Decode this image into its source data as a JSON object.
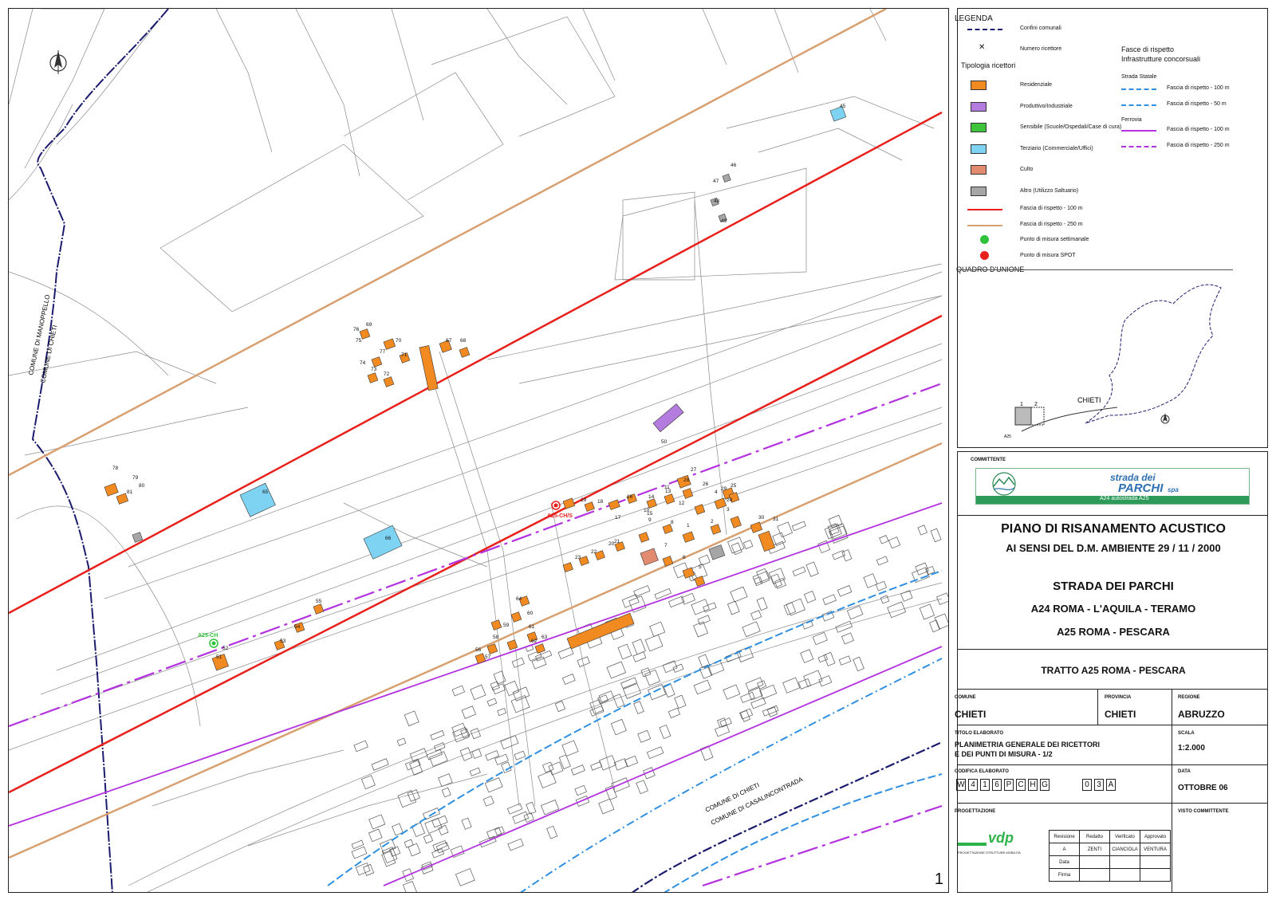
{
  "map": {
    "sheet_number": "1",
    "north_arrow_icon": "north-arrow-icon",
    "municipality_labels": [
      "COMUNE DI MANOPPELLO",
      "COMUNE DI CHIETI",
      "COMUNE DI CHIETI",
      "COMUNE DI CASALINCONTRADA"
    ],
    "measure_points": [
      {
        "id": "A25-CH/S",
        "type": "SPOT",
        "color": "#e8201c"
      },
      {
        "id": "A25-CH",
        "type": "settimanale",
        "color": "#2fc23a"
      }
    ],
    "receptor_numbers": [
      "1",
      "2",
      "3",
      "4",
      "5",
      "6",
      "7",
      "8",
      "9",
      "10",
      "11",
      "12",
      "13",
      "14",
      "15",
      "16",
      "17",
      "18",
      "19",
      "20",
      "21",
      "22",
      "23",
      "24",
      "25",
      "26",
      "27",
      "28",
      "29",
      "30",
      "31",
      "45",
      "46",
      "47",
      "48",
      "49",
      "50",
      "51",
      "52",
      "53",
      "54",
      "55",
      "56",
      "57",
      "58",
      "59",
      "60",
      "61",
      "62",
      "63",
      "64",
      "65",
      "66",
      "67",
      "68",
      "69",
      "70",
      "71",
      "72",
      "73",
      "74",
      "75",
      "76",
      "77",
      "78",
      "79",
      "80",
      "81"
    ],
    "colors": {
      "residenziale": "#f28a22",
      "produttivo": "#b57ce0",
      "sensibile": "#3ec43a",
      "terziario": "#7fd3f2",
      "culto": "#e28b70",
      "altro": "#a6a6a6",
      "fascia_100": "#e8201c",
      "fascia_250": "#d8a070",
      "strada_statale": "#2f8fe0",
      "ferrovia": "#b332e0",
      "confini": "#1c1c6e"
    }
  },
  "legend": {
    "title": "LEGENDA",
    "confini": "Confini comunali",
    "numero_ricettore": "Numero ricettore",
    "tipologia_title": "Tipologia ricettori",
    "types": [
      {
        "label": "Residenziale",
        "color": "#f28a22"
      },
      {
        "label": "Produttivo/Industriale",
        "color": "#b57ce0"
      },
      {
        "label": "Sensibile (Scuole/Ospedali/Case di cura)",
        "color": "#3ec43a"
      },
      {
        "label": "Terziario (Commerciale/Uffici)",
        "color": "#7fd3f2"
      },
      {
        "label": "Culto",
        "color": "#e28b70"
      },
      {
        "label": "Altro (Utilizzo Saltuario)",
        "color": "#a6a6a6"
      }
    ],
    "fascia_100": "Fascia di rispetto - 100 m",
    "fascia_250": "Fascia di rispetto - 250 m",
    "punto_settimanale": "Punto di misura settimanale",
    "punto_spot": "Punto di misura SPOT",
    "concorsuali_title_1": "Fasce di rispetto",
    "concorsuali_title_2": "Infrastrutture concorsuali",
    "strada_statale": "Strada Statale",
    "ss_100": "Fascia di rispetto - 100 m",
    "ss_50": "Fascia di rispetto - 50 m",
    "ferrovia": "Ferrovia",
    "fer_100": "Fascia di rispetto - 100 m",
    "fer_250": "Fascia di rispetto - 250 m",
    "quadro_title": "QUADRO D'UNIONE",
    "quadro_city": "CHIETI",
    "quadro_tiles": [
      "1",
      "2"
    ],
    "quadro_road": "A25"
  },
  "title_block": {
    "committente_label": "COMMITTENTE",
    "logo_line1": "strada dei",
    "logo_line2": "PARCHI",
    "logo_line2_suffix": "spa",
    "logo_bar": "A24 autostrada A25",
    "main_title": "PIANO DI RISANAMENTO ACUSTICO",
    "main_subtitle": "AI SENSI DEL D.M. AMBIENTE 29 / 11 / 2000",
    "project_1": "STRADA DEI PARCHI",
    "project_2": "A24 ROMA - L'AQUILA - TERAMO",
    "project_3": "A25 ROMA - PESCARA",
    "tratto": "TRATTO A25 ROMA - PESCARA",
    "comune_label": "COMUNE",
    "comune": "CHIETI",
    "provincia_label": "PROVINCIA",
    "provincia": "CHIETI",
    "regione_label": "REGIONE",
    "regione": "ABRUZZO",
    "titolo_label": "TITOLO ELABORATO",
    "titolo_1": "PLANIMETRIA GENERALE DEI RICETTORI",
    "titolo_2": "E DEI PUNTI DI MISURA - 1/2",
    "scala_label": "SCALA",
    "scala": "1:2.000",
    "codifica_label": "CODIFICA ELABORATO",
    "codifica_1": [
      "W",
      "4",
      "1",
      "6",
      "P",
      "C",
      "H",
      "G"
    ],
    "codifica_2": [
      "0",
      "3",
      "A"
    ],
    "data_label": "DATA",
    "data": "OTTOBRE 06",
    "progettazione_label": "PROGETTAZIONE",
    "logo_vdp": "vdp",
    "vdp_sub": "PROGETTAZIONE STRUTTURE MOBILITA",
    "visto_label": "VISTO COMMITTENTE",
    "rev_headers": [
      "Revisione",
      "Redatto",
      "Verificato",
      "Approvato"
    ],
    "rev_rows": [
      [
        "A",
        "ZENTI",
        "CIANCIOLA",
        "VENTURA"
      ],
      [
        "Data",
        "",
        "",
        ""
      ],
      [
        "Firma",
        "",
        "",
        ""
      ]
    ]
  }
}
